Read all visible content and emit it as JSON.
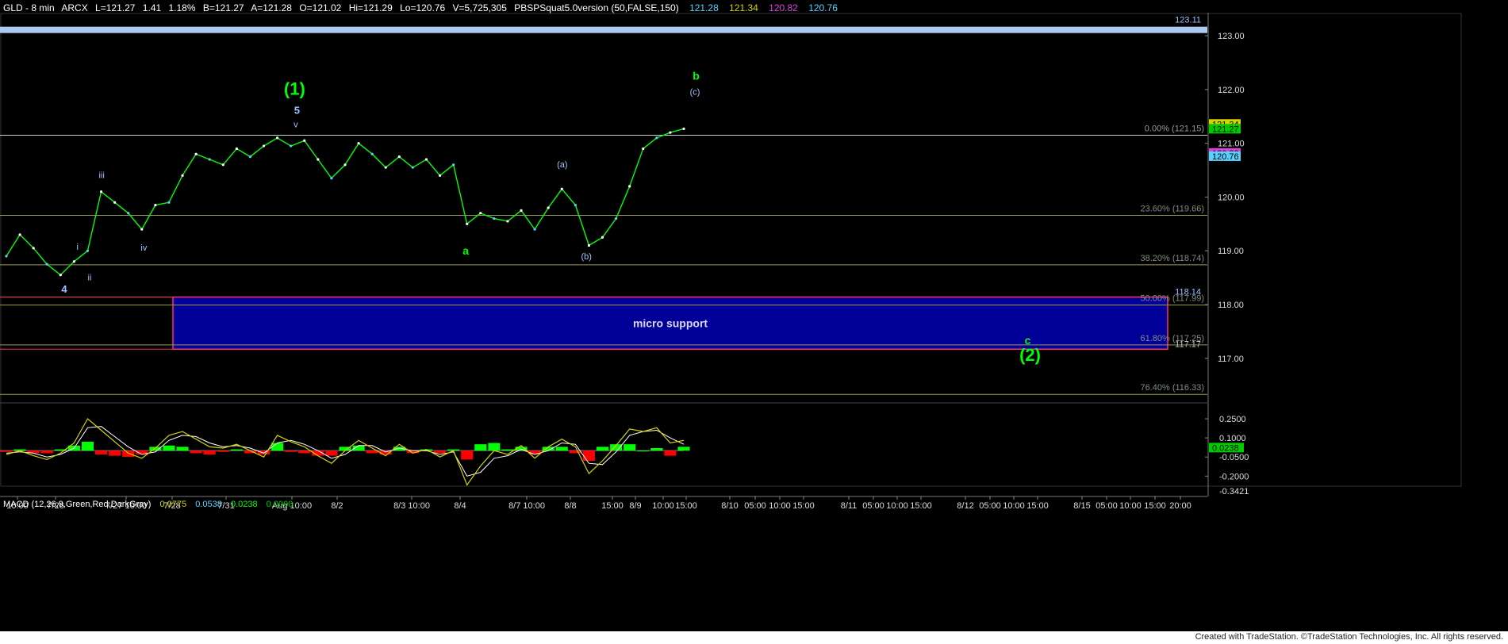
{
  "header": {
    "title": "GLD - 8 min",
    "exchange": "ARCX",
    "last": "L=121.27",
    "change": "1.41",
    "change_pct": "1.18%",
    "bid": "B=121.27",
    "ask": "A=121.28",
    "open": "O=121.02",
    "high": "Hi=121.29",
    "low": "Lo=120.76",
    "volume": "V=5,725,305",
    "indicator": "PBSPSquat5.0version (50,FALSE,150)",
    "ind_values": [
      {
        "text": "121.28",
        "color": "#5ad0ff"
      },
      {
        "text": "121.34",
        "color": "#d4d400"
      },
      {
        "text": "120.82",
        "color": "#e040e0"
      },
      {
        "text": "120.76",
        "color": "#5ad0ff"
      }
    ]
  },
  "colors": {
    "bull": "#00ff00",
    "bear": "#ff0000",
    "price": "#00ff00",
    "fib": "#9a9a5a",
    "zone_fill": "#000099",
    "zone_border": "#ff3366",
    "resistance": "#aec9ee",
    "wave_green": "#00ff00",
    "wave_blue": "#9ec4ff"
  },
  "chart_data": [
    {
      "type": "line",
      "symbol": "GLD",
      "interval": "8 min",
      "ylim": [
        116.2,
        123.4
      ],
      "yticks": [
        117.0,
        118.0,
        119.0,
        120.0,
        121.0,
        122.0,
        123.0
      ],
      "ytick_labels": [
        "117.00",
        "118.00",
        "119.00",
        "120.00",
        "121.00",
        "122.00",
        "123.00"
      ],
      "xlabels": [
        "10:00",
        "7/26",
        "7/27 10:00",
        "7/28",
        "7/31",
        "Aug 10:00",
        "8/2",
        "8/3 10:00",
        "8/4",
        "8/7 10:00",
        "8/8",
        "15:00",
        "8/9",
        "10:00",
        "15:00",
        "8/10",
        "05:00",
        "10:00",
        "15:00",
        "8/11",
        "05:00",
        "10:00",
        "15:00",
        "8/12",
        "05:00",
        "10:00",
        "15:00",
        "8/15",
        "05:00",
        "10:00",
        "15:00",
        "20:00"
      ],
      "price": [
        118.9,
        119.3,
        119.05,
        118.75,
        118.55,
        118.8,
        119.0,
        120.1,
        119.9,
        119.7,
        119.4,
        119.85,
        119.9,
        120.4,
        120.8,
        120.7,
        120.6,
        120.9,
        120.75,
        120.95,
        121.1,
        120.95,
        121.05,
        120.7,
        120.35,
        120.6,
        121.0,
        120.8,
        120.55,
        120.75,
        120.55,
        120.7,
        120.4,
        120.6,
        119.5,
        119.7,
        119.6,
        119.55,
        119.75,
        119.4,
        119.8,
        120.15,
        119.85,
        119.1,
        119.25,
        119.6,
        120.2,
        120.9,
        121.1,
        121.2,
        121.27
      ],
      "levels": [
        {
          "name": "resistance",
          "value": 123.11,
          "label": "123.11"
        },
        {
          "name": "fib-0",
          "value": 121.15,
          "label": "0.00% (121.15)"
        },
        {
          "name": "fib-23.6",
          "value": 119.66,
          "label": "23.60% (119.66)"
        },
        {
          "name": "fib-38.2",
          "value": 118.74,
          "label": "38.20% (118.74)"
        },
        {
          "name": "fib-50",
          "value": 117.99,
          "label": "50.00% (117.99)"
        },
        {
          "name": "fib-61.8",
          "value": 117.25,
          "label": "61.80% (117.25)"
        },
        {
          "name": "fib-76.4",
          "value": 116.33,
          "label": "76.40% (116.33)"
        }
      ],
      "zone": {
        "label": "micro support",
        "top": 118.14,
        "bottom": 117.17,
        "top_label": "118.14",
        "bottom_label": "117.17"
      },
      "price_tags": [
        {
          "value": 121.36,
          "text": "121.34",
          "bg": "#d4d400",
          "fg": "#000"
        },
        {
          "value": 121.27,
          "text": "121.27",
          "bg": "#00cc00",
          "fg": "#000"
        },
        {
          "value": 120.82,
          "text": "120.82",
          "bg": "#e040e0",
          "fg": "#000"
        },
        {
          "value": 120.76,
          "text": "120.76",
          "bg": "#5ad0ff",
          "fg": "#000"
        }
      ],
      "wave_labels": [
        {
          "text": "(1)",
          "x": 0.243,
          "y": 121.9,
          "color": "wave_green",
          "size": 22,
          "bold": true
        },
        {
          "text": "5",
          "x": 0.245,
          "y": 121.55,
          "color": "wave_blue",
          "size": 13,
          "bold": true
        },
        {
          "text": "v",
          "x": 0.244,
          "y": 121.3,
          "color": "wave_blue",
          "size": 11,
          "bold": false
        },
        {
          "text": "b",
          "x": 0.576,
          "y": 122.18,
          "color": "wave_green",
          "size": 14,
          "bold": true
        },
        {
          "text": "(c)",
          "x": 0.575,
          "y": 121.9,
          "color": "wave_blue",
          "size": 11,
          "bold": false
        },
        {
          "text": "(a)",
          "x": 0.465,
          "y": 120.55,
          "color": "wave_blue",
          "size": 11,
          "bold": false
        },
        {
          "text": "iii",
          "x": 0.083,
          "y": 120.35,
          "color": "wave_blue",
          "size": 11,
          "bold": false
        },
        {
          "text": "iv",
          "x": 0.118,
          "y": 119.0,
          "color": "wave_blue",
          "size": 11,
          "bold": false
        },
        {
          "text": "i",
          "x": 0.063,
          "y": 119.02,
          "color": "wave_blue",
          "size": 11,
          "bold": false
        },
        {
          "text": "ii",
          "x": 0.073,
          "y": 118.45,
          "color": "wave_blue",
          "size": 11,
          "bold": false
        },
        {
          "text": "4",
          "x": 0.052,
          "y": 118.22,
          "color": "wave_blue",
          "size": 13,
          "bold": true
        },
        {
          "text": "a",
          "x": 0.385,
          "y": 118.93,
          "color": "wave_green",
          "size": 14,
          "bold": true
        },
        {
          "text": "(b)",
          "x": 0.485,
          "y": 118.84,
          "color": "wave_blue",
          "size": 11,
          "bold": false
        },
        {
          "text": "c",
          "x": 0.851,
          "y": 117.26,
          "color": "wave_green",
          "size": 14,
          "bold": true
        },
        {
          "text": "(2)",
          "x": 0.853,
          "y": 116.95,
          "color": "wave_green",
          "size": 22,
          "bold": true
        }
      ]
    },
    {
      "type": "line",
      "name": "MACD",
      "legend": "MACD (12,26,9,Green,Red,DarkGray)",
      "legend_values": [
        {
          "text": "0.0775",
          "color": "#d4d400"
        },
        {
          "text": "0.0538",
          "color": "#5ad0ff"
        },
        {
          "text": "0.0238",
          "color": "#00ff00"
        },
        {
          "text": "0.0000",
          "color": "#00cc00"
        }
      ],
      "ylim": [
        -0.36,
        0.3
      ],
      "yticks": [
        0.25,
        0.1,
        -0.05,
        -0.2
      ],
      "ytick_labels": [
        "0.2500",
        "0.1000",
        "-0.0500",
        "-0.2000"
      ],
      "bottom_label": "-0.3421",
      "current_tag": {
        "value": 0.0238,
        "text": "0.0238"
      },
      "macd": [
        -0.03,
        0.0,
        -0.04,
        -0.07,
        -0.02,
        0.06,
        0.25,
        0.16,
        0.07,
        -0.02,
        -0.06,
        0.02,
        0.12,
        0.15,
        0.09,
        0.03,
        0.02,
        0.05,
        0.0,
        -0.05,
        0.12,
        0.07,
        0.03,
        -0.04,
        -0.1,
        0.0,
        0.08,
        0.02,
        -0.04,
        0.05,
        -0.02,
        0.01,
        -0.05,
        0.0,
        -0.27,
        -0.12,
        0.0,
        -0.03,
        0.04,
        -0.06,
        0.03,
        0.09,
        0.03,
        -0.18,
        -0.08,
        0.04,
        0.17,
        0.15,
        0.18,
        0.06,
        0.08
      ],
      "signal": [
        -0.02,
        -0.01,
        -0.02,
        -0.05,
        -0.03,
        0.02,
        0.18,
        0.19,
        0.11,
        0.03,
        -0.03,
        -0.01,
        0.08,
        0.12,
        0.11,
        0.06,
        0.03,
        0.04,
        0.02,
        -0.02,
        0.06,
        0.08,
        0.05,
        0.0,
        -0.06,
        -0.03,
        0.04,
        0.04,
        -0.01,
        0.02,
        0.0,
        0.0,
        -0.03,
        -0.01,
        -0.2,
        -0.17,
        -0.06,
        -0.04,
        0.01,
        -0.03,
        0.0,
        0.06,
        0.05,
        -0.1,
        -0.11,
        -0.01,
        0.12,
        0.15,
        0.16,
        0.1,
        0.05
      ],
      "histogram": [
        -0.01,
        0.01,
        -0.02,
        -0.02,
        0.01,
        0.04,
        0.07,
        -0.03,
        -0.04,
        -0.05,
        -0.03,
        0.03,
        0.04,
        0.03,
        -0.02,
        -0.03,
        -0.01,
        0.01,
        -0.02,
        -0.03,
        0.06,
        -0.01,
        -0.02,
        -0.04,
        -0.04,
        0.03,
        0.04,
        -0.02,
        -0.03,
        0.03,
        -0.02,
        0.01,
        -0.02,
        0.01,
        -0.07,
        0.05,
        0.06,
        0.01,
        0.03,
        -0.03,
        0.03,
        0.03,
        -0.02,
        -0.08,
        0.03,
        0.05,
        0.05,
        0.0,
        0.02,
        -0.04,
        0.03
      ]
    }
  ],
  "footer": {
    "text": "Created with TradeStation. ©TradeStation Technologies, Inc. All rights reserved."
  }
}
